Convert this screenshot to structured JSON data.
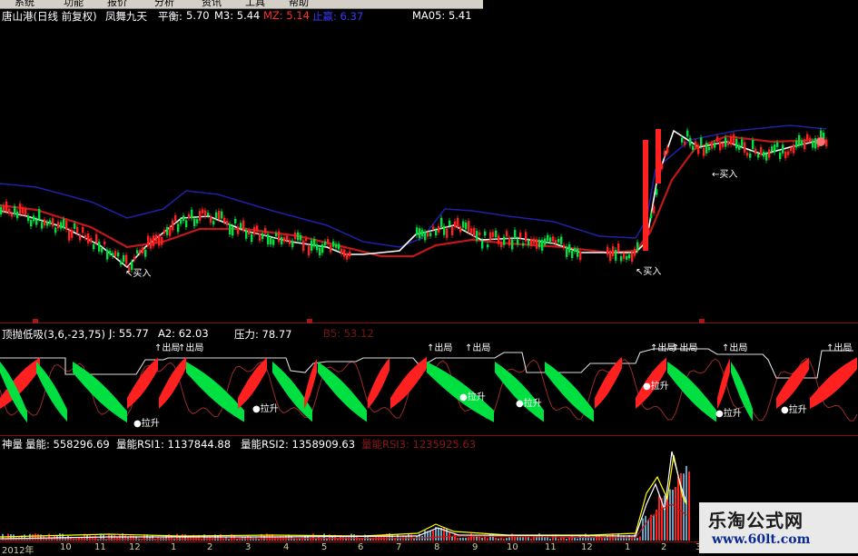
{
  "menu": {
    "items": [
      "系统",
      "功能",
      "报价",
      "分析",
      "资讯",
      "工具",
      "帮助"
    ]
  },
  "header": {
    "stock": "唐山港(日线 前复权)",
    "indicator": "凤舞九天",
    "balance_label": "平衡:",
    "balance_value": "5.70",
    "m3": "M3: 5.44",
    "mz": "MZ: 5.14",
    "upper": "止赢: 6.37",
    "ma05": "MA05: 5.41"
  },
  "main_chart": {
    "buy_label": "买入"
  },
  "mid_panel": {
    "title": "顶抛低吸(3,6,-23,75)",
    "j": "J: 55.77",
    "a2": "A2: 62.03",
    "pressure": "压力: 78.77",
    "b5": "B5: 53.12",
    "sell_label": "出局",
    "pull_label": "拉升"
  },
  "vol_panel": {
    "title": "神量",
    "liangneng": "量能: 558296.69",
    "rsi1": "量能RSI1: 1137844.88",
    "rsi2": "量能RSI2: 1358909.63",
    "rsi3": "量能RSI3: 1235925.63"
  },
  "axis": {
    "labels": [
      "2012年",
      "10",
      "11",
      "12",
      "1",
      "2",
      "3",
      "4",
      "5",
      "6",
      "7",
      "8",
      "9",
      "10",
      "11",
      "12",
      "1",
      "2",
      "3",
      "4"
    ]
  },
  "watermark": {
    "cn": "乐淘公式网",
    "url": "www.60lt.com"
  },
  "colors": {
    "up": "#ff2020",
    "down": "#00e040",
    "ma_white": "#ffffff",
    "ma_red": "#c01818",
    "band_blue": "#2020a8",
    "yellow": "#ffff00"
  }
}
